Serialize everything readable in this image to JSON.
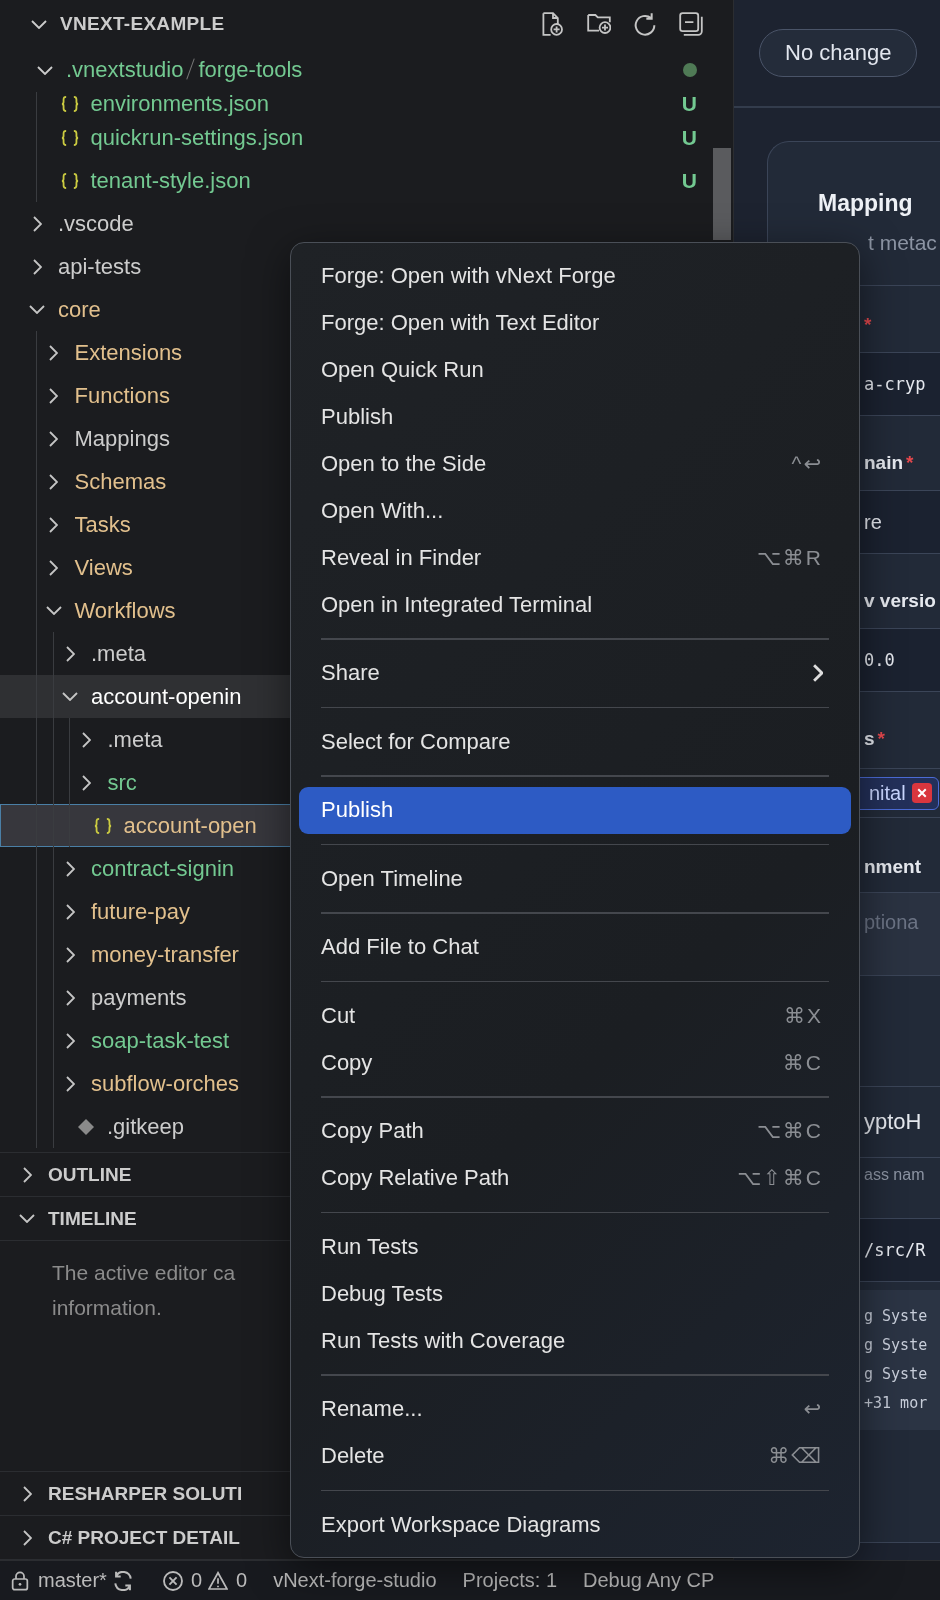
{
  "explorer": {
    "title": "VNEXT-EXAMPLE",
    "expanded": true,
    "tree": [
      {
        "segments": [
          ".vnextstudio",
          "forge-tools"
        ],
        "kind": "folder",
        "expanded": true,
        "color": "#73c991",
        "dot": true,
        "children": [
          {
            "name": "environments.json",
            "kind": "file",
            "color": "#73c991",
            "badge": "U"
          },
          {
            "name": "quickrun-settings.json",
            "kind": "file",
            "color": "#73c991",
            "badge": "U"
          },
          {
            "name": "tenant-style.json",
            "kind": "file",
            "color": "#73c991",
            "badge": "U"
          }
        ]
      },
      {
        "name": ".vscode",
        "kind": "folder",
        "expanded": false,
        "color": "#cccccc"
      },
      {
        "name": "api-tests",
        "kind": "folder",
        "expanded": false,
        "color": "#cccccc"
      },
      {
        "name": "core",
        "kind": "folder",
        "expanded": true,
        "color": "#e2c08d",
        "children": [
          {
            "name": "Extensions",
            "kind": "folder",
            "expanded": false,
            "color": "#e2c08d"
          },
          {
            "name": "Functions",
            "kind": "folder",
            "expanded": false,
            "color": "#e2c08d"
          },
          {
            "name": "Mappings",
            "kind": "folder",
            "expanded": false,
            "color": "#cccccc"
          },
          {
            "name": "Schemas",
            "kind": "folder",
            "expanded": false,
            "color": "#e2c08d"
          },
          {
            "name": "Tasks",
            "kind": "folder",
            "expanded": false,
            "color": "#e2c08d"
          },
          {
            "name": "Views",
            "kind": "folder",
            "expanded": false,
            "color": "#e2c08d"
          },
          {
            "name": "Workflows",
            "kind": "folder",
            "expanded": true,
            "color": "#e2c08d",
            "children": [
              {
                "name": ".meta",
                "kind": "folder",
                "expanded": false,
                "color": "#cccccc"
              },
              {
                "name": "account-openin",
                "kind": "folder",
                "expanded": true,
                "color": "#ffffff",
                "hovered": true,
                "children": [
                  {
                    "name": ".meta",
                    "kind": "folder",
                    "expanded": false,
                    "color": "#cccccc"
                  },
                  {
                    "name": "src",
                    "kind": "folder",
                    "expanded": false,
                    "color": "#73c991"
                  },
                  {
                    "name": "account-open",
                    "kind": "file",
                    "color": "#e2c08d",
                    "selected": true
                  }
                ]
              },
              {
                "name": "contract-signin",
                "kind": "folder",
                "expanded": false,
                "color": "#73c991"
              },
              {
                "name": "future-pay",
                "kind": "folder",
                "expanded": false,
                "color": "#e2c08d"
              },
              {
                "name": "money-transfer",
                "kind": "folder",
                "expanded": false,
                "color": "#e2c08d"
              },
              {
                "name": "payments",
                "kind": "folder",
                "expanded": false,
                "color": "#cccccc"
              },
              {
                "name": "soap-task-test",
                "kind": "folder",
                "expanded": false,
                "color": "#73c991"
              },
              {
                "name": "subflow-orches",
                "kind": "folder",
                "expanded": false,
                "color": "#e2c08d"
              },
              {
                "name": ".gitkeep",
                "kind": "gitfile",
                "color": "#cccccc"
              }
            ]
          }
        ]
      }
    ]
  },
  "panels": [
    {
      "title": "OUTLINE",
      "expanded": false
    },
    {
      "title": "TIMELINE",
      "expanded": true,
      "message_lines": [
        "The active editor ca",
        "information."
      ]
    },
    {
      "title": "RESHARPER SOLUTI",
      "expanded": false
    },
    {
      "title": "C# PROJECT DETAIL",
      "expanded": false
    }
  ],
  "editor": {
    "button": "No change",
    "card": {
      "title": "Mapping",
      "subtitle": "t metac",
      "items": [
        {
          "kind": "label",
          "mark": "*"
        },
        {
          "kind": "input",
          "value": "a-cryp"
        },
        {
          "kind": "label",
          "text": "nain",
          "mark": "*"
        },
        {
          "kind": "select",
          "value": "re"
        },
        {
          "kind": "label",
          "text": "v versio"
        },
        {
          "kind": "input",
          "value": "0.0"
        },
        {
          "kind": "label",
          "text": "s",
          "mark": "*"
        },
        {
          "kind": "tags",
          "tags": [
            "nital"
          ]
        },
        {
          "kind": "label",
          "text": "nment"
        },
        {
          "kind": "textarea",
          "placeholder": "ptiona"
        },
        {
          "kind": "big",
          "value": "yptoH"
        },
        {
          "kind": "hint",
          "text": "ass nam"
        },
        {
          "kind": "input",
          "value": "/src/R"
        },
        {
          "kind": "code",
          "lines": [
            "g Syste",
            "g Syste",
            "g Syste"
          ],
          "more": "+31 mor"
        }
      ]
    }
  },
  "context_menu": {
    "groups": [
      [
        {
          "label": "Forge: Open with vNext Forge",
          "selected": false
        },
        {
          "label": "Forge: Open with Text Editor",
          "selected": false
        },
        {
          "label": "Open Quick Run",
          "selected": false
        },
        {
          "label": "Publish",
          "selected": false
        },
        {
          "label": "Open to the Side",
          "shortcut": "^↩",
          "selected": false
        },
        {
          "label": "Open With...",
          "selected": false
        },
        {
          "label": "Reveal in Finder",
          "shortcut": "⌥⌘R",
          "selected": false
        },
        {
          "label": "Open in Integrated Terminal",
          "selected": false
        }
      ],
      [
        {
          "label": "Share",
          "submenu": true,
          "selected": false
        }
      ],
      [
        {
          "label": "Select for Compare",
          "selected": false
        }
      ],
      [
        {
          "label": "Publish",
          "selected": true
        }
      ],
      [
        {
          "label": "Open Timeline",
          "selected": false
        }
      ],
      [
        {
          "label": "Add File to Chat",
          "selected": false
        }
      ],
      [
        {
          "label": "Cut",
          "shortcut": "⌘X",
          "selected": false
        },
        {
          "label": "Copy",
          "shortcut": "⌘C",
          "selected": false
        }
      ],
      [
        {
          "label": "Copy Path",
          "shortcut": "⌥⌘C",
          "selected": false
        },
        {
          "label": "Copy Relative Path",
          "shortcut": "⌥⇧⌘C",
          "selected": false
        }
      ],
      [
        {
          "label": "Run Tests",
          "selected": false
        },
        {
          "label": "Debug Tests",
          "selected": false
        },
        {
          "label": "Run Tests with Coverage",
          "selected": false
        }
      ],
      [
        {
          "label": "Rename...",
          "shortcut": "↩",
          "selected": false
        },
        {
          "label": "Delete",
          "shortcut": "⌘⌫",
          "selected": false
        }
      ],
      [
        {
          "label": "Export Workspace Diagrams",
          "selected": false
        }
      ]
    ]
  },
  "status_bar": {
    "branch": "master*",
    "errors": "0",
    "warnings": "0",
    "items": [
      "vNext-forge-studio",
      "Projects: 1",
      "Debug Any CP"
    ]
  }
}
